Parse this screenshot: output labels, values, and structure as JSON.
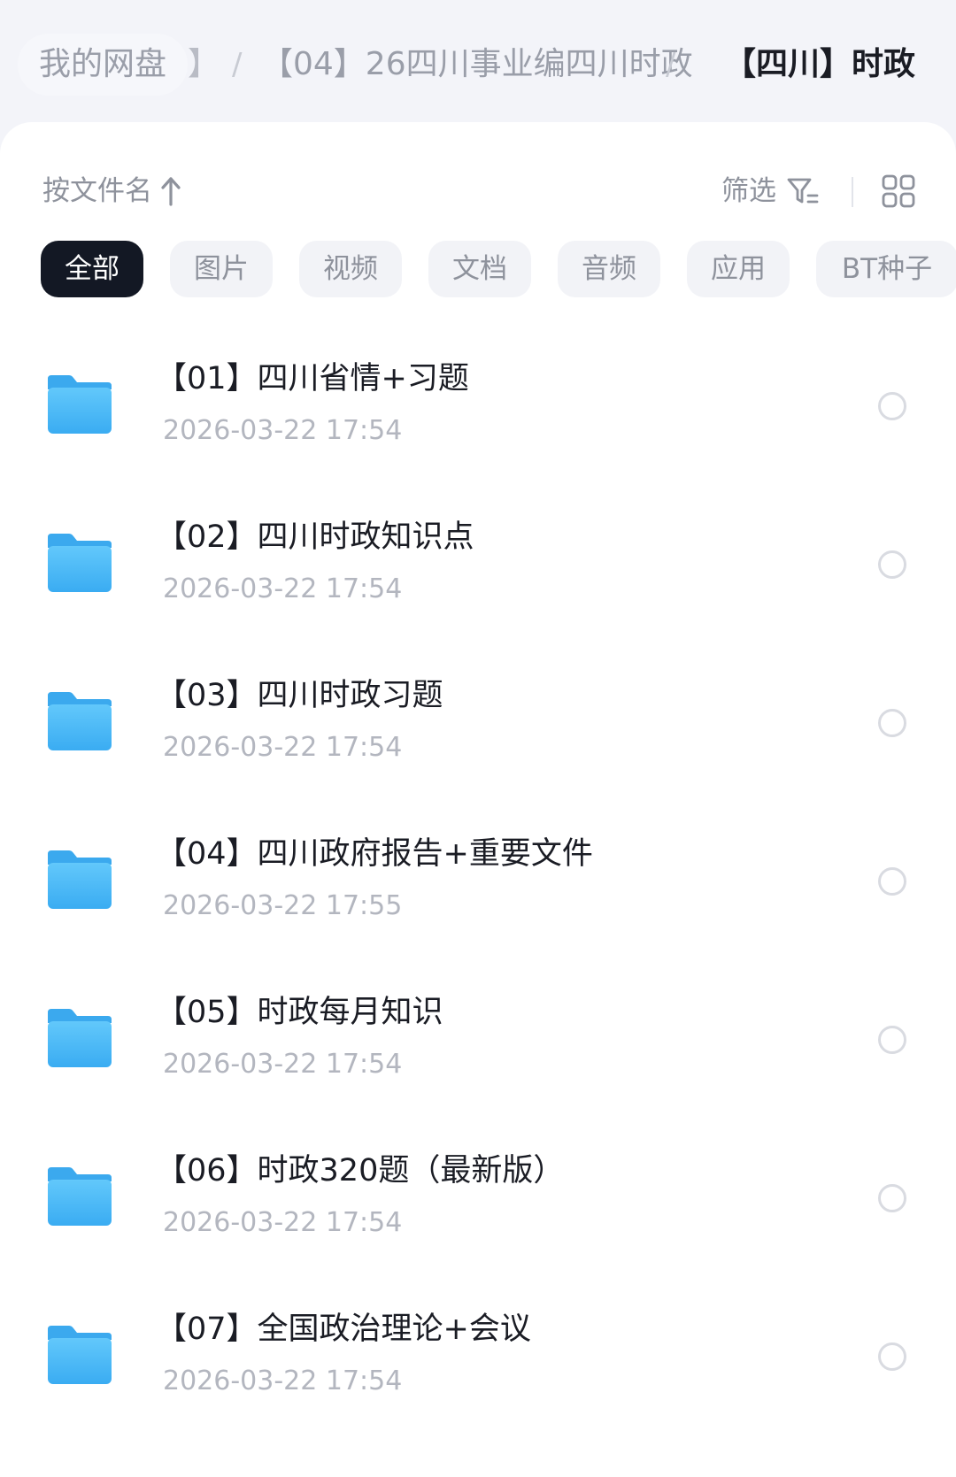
{
  "breadcrumb": {
    "home": "我的网盘",
    "clipped": "】",
    "separator": "/",
    "middle": "【04】26四川事业编四川时政",
    "current": "【四川】时政"
  },
  "toolbar": {
    "sort_label": "按文件名",
    "filter_label": "筛选"
  },
  "chips": [
    "全部",
    "图片",
    "视频",
    "文档",
    "音频",
    "应用",
    "BT种子"
  ],
  "active_chip": "全部",
  "files": [
    {
      "name": "【01】四川省情+习题",
      "date": "2026-03-22  17:54"
    },
    {
      "name": "【02】四川时政知识点",
      "date": "2026-03-22  17:54"
    },
    {
      "name": "【03】四川时政习题",
      "date": "2026-03-22  17:54"
    },
    {
      "name": "【04】四川政府报告+重要文件",
      "date": "2026-03-22  17:55"
    },
    {
      "name": "【05】时政每月知识",
      "date": "2026-03-22  17:54"
    },
    {
      "name": "【06】时政320题（最新版）",
      "date": "2026-03-22  17:54"
    },
    {
      "name": "【07】全国政治理论+会议",
      "date": "2026-03-22  17:54"
    }
  ],
  "colors": {
    "accent_chip": "#131824",
    "folder_top": "#5ec5fb",
    "folder_bottom": "#3aacf2"
  },
  "icons": {
    "sort": "arrow-up-icon",
    "filter": "filter-icon",
    "view": "grid-view-icon",
    "item": "folder-icon",
    "select": "select-circle-icon"
  }
}
